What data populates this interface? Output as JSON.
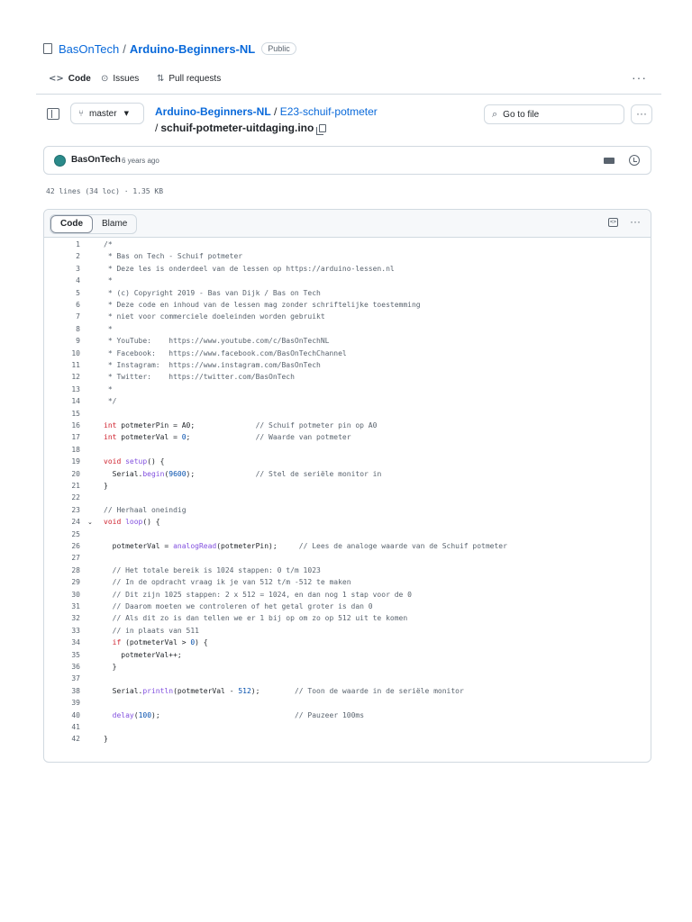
{
  "header": {
    "owner": "BasOnTech",
    "separator": "/",
    "repo": "Arduino-Beginners-NL",
    "visibility": "Public"
  },
  "nav": {
    "tabs": [
      {
        "label": "Code",
        "icon": "code-icon",
        "active": true
      },
      {
        "label": "Issues",
        "icon": "issue-icon",
        "active": false
      },
      {
        "label": "Pull requests",
        "icon": "pull-request-icon",
        "active": false
      }
    ],
    "more": "···"
  },
  "file_nav": {
    "branch": "master",
    "breadcrumb_repo": "Arduino-Beginners-NL",
    "breadcrumb_sep": "/",
    "breadcrumb_folder": "E23-schuif-potmeter",
    "file_name": "schuif-potmeter-uitdaging.ino",
    "goto_placeholder": "Go to file",
    "more": "···"
  },
  "commit": {
    "author": "BasOnTech",
    "time": "6 years ago"
  },
  "meta": "42 lines (34 loc) · 1.35 KB",
  "file": {
    "tab_code": "Code",
    "tab_blame": "Blame",
    "more": "···",
    "lines": [
      "/*",
      " * Bas on Tech - Schuif potmeter",
      " * Deze les is onderdeel van de lessen op https://arduino-lessen.nl",
      " *",
      " * (c) Copyright 2019 - Bas van Dijk / Bas on Tech",
      " * Deze code en inhoud van de lessen mag zonder schriftelijke toestemming",
      " * niet voor commerciele doeleinden worden gebruikt",
      " *",
      " * YouTube:    https://www.youtube.com/c/BasOnTechNL",
      " * Facebook:   https://www.facebook.com/BasOnTechChannel",
      " * Instagram:  https://www.instagram.com/BasOnTech",
      " * Twitter:    https://twitter.com/BasOnTech",
      " *",
      " */",
      "",
      "int potmeterPin = A0;              // Schuif potmeter pin op A0",
      "int potmeterVal = 0;               // Waarde van potmeter",
      "",
      "void setup() {",
      "  Serial.begin(9600);              // Stel de seriële monitor in",
      "}",
      "",
      "// Herhaal oneindig",
      "void loop() {",
      "",
      "  potmeterVal = analogRead(potmeterPin);     // Lees de analoge waarde van de Schuif potmeter",
      "",
      "  // Het totale bereik is 1024 stappen: 0 t/m 1023",
      "  // In de opdracht vraag ik je van 512 t/m -512 te maken",
      "  // Dit zijn 1025 stappen: 2 x 512 = 1024, en dan nog 1 stap voor de 0",
      "  // Daarom moeten we controleren of het getal groter is dan 0",
      "  // Als dit zo is dan tellen we er 1 bij op om zo op 512 uit te komen",
      "  // in plaats van 511",
      "  if (potmeterVal > 0) {",
      "    potmeterVal++;",
      "  }",
      "",
      "  Serial.println(potmeterVal - 512);        // Toon de waarde in de seriële monitor",
      "",
      "  delay(100);                               // Pauzeer 100ms",
      "",
      "}"
    ]
  }
}
